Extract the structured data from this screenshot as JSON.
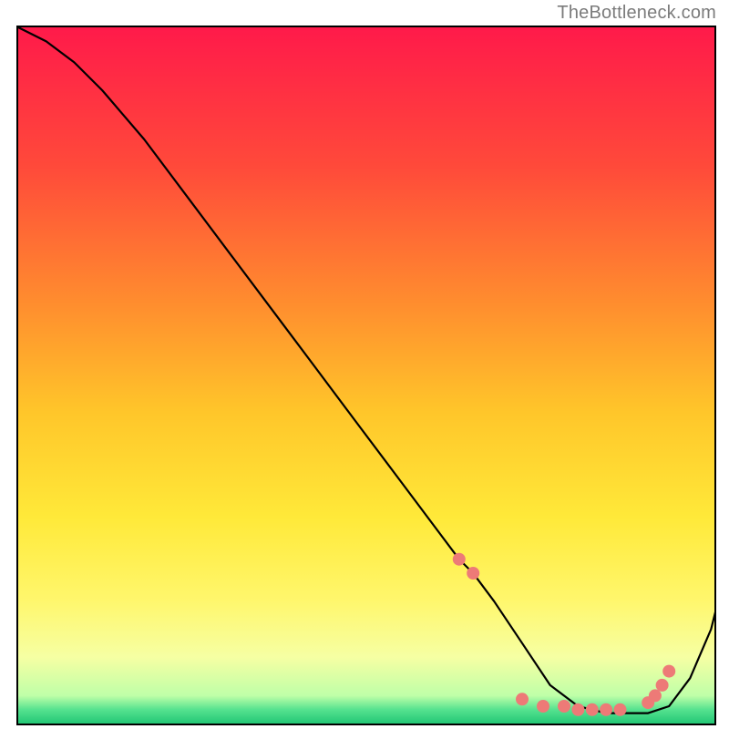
{
  "watermark": "TheBottleneck.com",
  "chart_data": {
    "type": "line",
    "title": "",
    "xlabel": "",
    "ylabel": "",
    "xlim": [
      0,
      100
    ],
    "ylim": [
      0,
      100
    ],
    "grid": false,
    "series": [
      {
        "name": "bottleneck-curve",
        "x": [
          0,
          4,
          8,
          12,
          18,
          24,
          30,
          36,
          42,
          48,
          54,
          60,
          63,
          65,
          68,
          72,
          76,
          80,
          84,
          87,
          90,
          93,
          96,
          99,
          100
        ],
        "y": [
          100,
          98,
          95,
          91,
          84,
          76,
          68,
          60,
          52,
          44,
          36,
          28,
          24,
          22,
          18,
          12,
          6,
          3,
          2,
          2,
          2,
          3,
          7,
          14,
          18
        ]
      }
    ],
    "markers": {
      "name": "highlight-dots",
      "x": [
        63,
        65,
        72,
        75,
        78,
        80,
        82,
        84,
        86,
        90,
        91,
        92,
        93
      ],
      "y": [
        24,
        22,
        4,
        3,
        3,
        2.5,
        2.5,
        2.5,
        2.5,
        3.5,
        4.5,
        6,
        8
      ]
    },
    "colors": {
      "curve": "#000000",
      "markers": "#ed7a77",
      "gradient_top": "#ff1a4a",
      "gradient_bottom": "#16c06f"
    }
  }
}
